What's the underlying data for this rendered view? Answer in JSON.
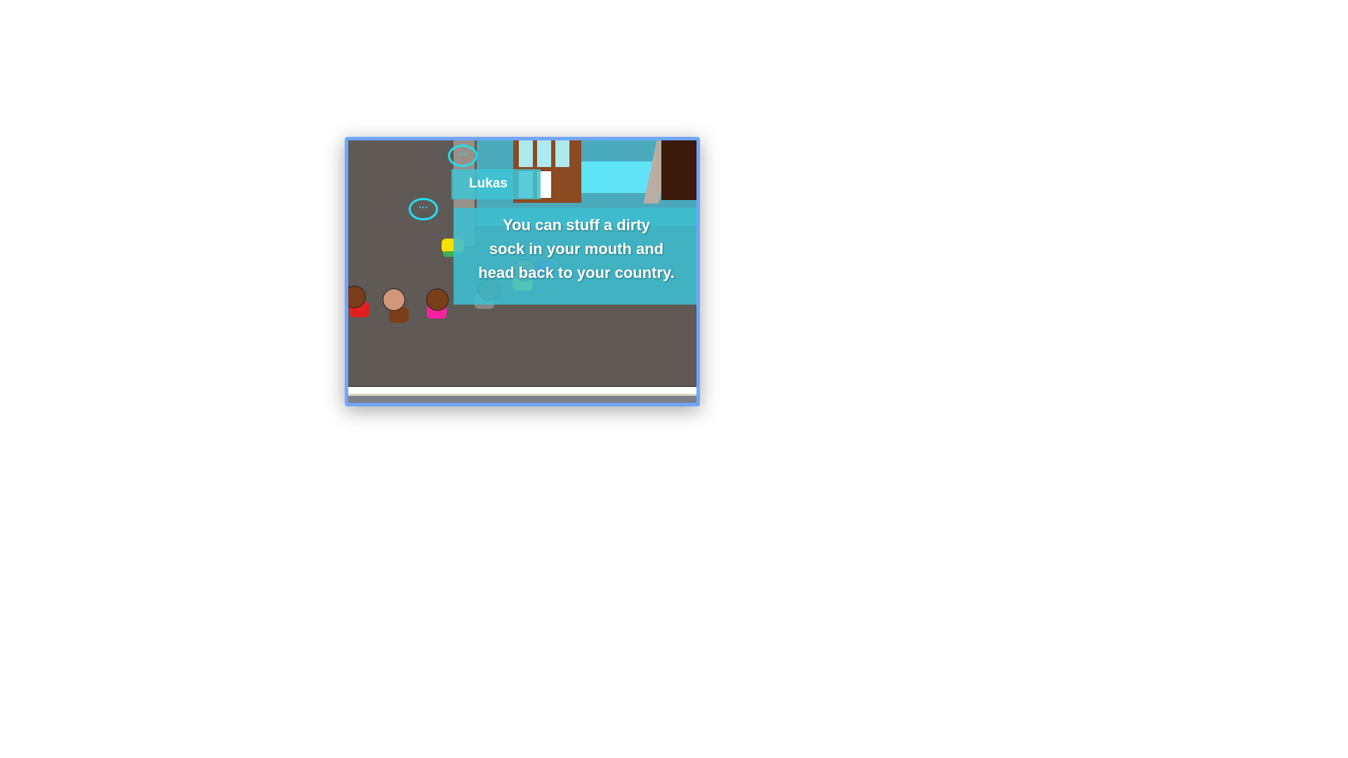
{
  "dialogue": {
    "speaker": "Lukas",
    "lines": [
      "You can stuff a dirty",
      "sock in your mouth and",
      "head back to your country."
    ]
  },
  "icons": [
    "speech-bubble-icon"
  ],
  "colors": {
    "frame_border": "#6fa6ff",
    "dialog_bg": "#3cbed0",
    "bubble": "#1fe0f2",
    "road": "#5f5a55"
  }
}
